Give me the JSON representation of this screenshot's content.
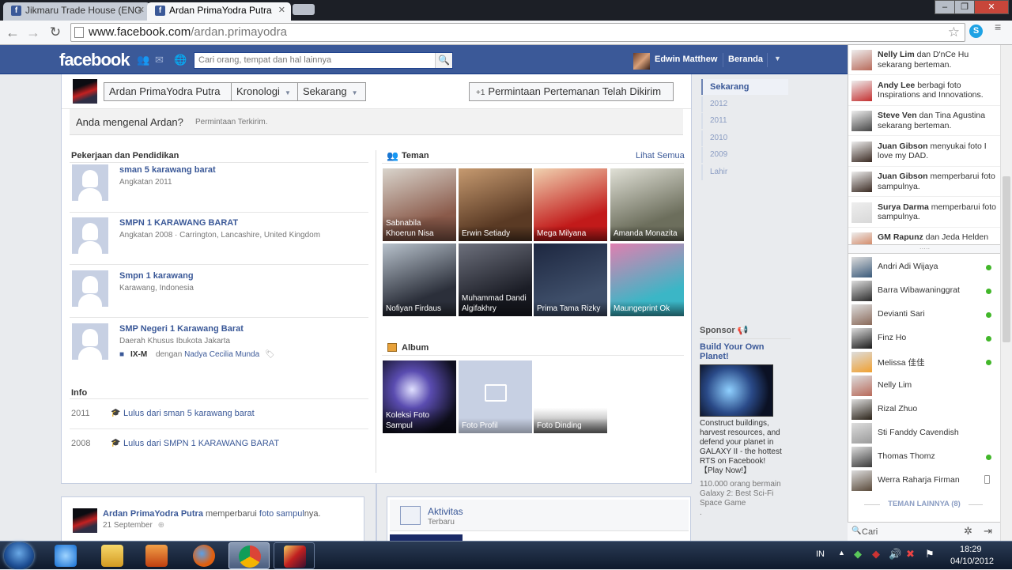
{
  "browser": {
    "tabs": [
      {
        "label": "Jikmaru Trade House (ENG"
      },
      {
        "label": "Ardan PrimaYodra Putra"
      }
    ],
    "url_host": "www.facebook.com",
    "url_path": "/ardan.primayodra"
  },
  "fb": {
    "logo": "facebook",
    "search_placeholder": "Cari orang, tempat dan hal lainnya",
    "user_name": "Edwin Matthew",
    "home_label": "Beranda"
  },
  "profile": {
    "name_btn": "Ardan PrimaYodra Putra",
    "kronologi_btn": "Kronologi",
    "sekarang_btn": "Sekarang",
    "friend_request_btn": "Permintaan Pertemanan Telah Dikirim",
    "know_question": "Anda mengenal Ardan?",
    "know_status": "Permintaan Terkirim."
  },
  "work": {
    "heading": "Pekerjaan dan Pendidikan",
    "items": [
      {
        "title": "sman 5 karawang barat",
        "detail": "Angkatan 2011"
      },
      {
        "title": "SMPN 1 KARAWANG BARAT",
        "detail": "Angkatan 2008 · Carrington, Lancashire, United Kingdom"
      },
      {
        "title": "Smpn 1 karawang",
        "detail": "Karawang, Indonesia"
      },
      {
        "title": "SMP Negeri 1 Karawang Barat",
        "detail": "Daerah Khusus Ibukota Jakarta",
        "class": "IX-M",
        "with": "dengan",
        "with_name": "Nadya Cecilia Munda"
      }
    ]
  },
  "info": {
    "heading": "Info",
    "rows": [
      {
        "year": "2011",
        "text": "Lulus dari sman 5 karawang barat"
      },
      {
        "year": "2008",
        "text": "Lulus dari SMPN 1 KARAWANG BARAT"
      }
    ]
  },
  "friends": {
    "heading": "Teman",
    "see_all": "Lihat Semua",
    "items": [
      {
        "name": "Sabnabila Khoerun Nisa",
        "c1": "#8a5a4a",
        "c2": "#d9d4cc"
      },
      {
        "name": "Erwin Setiady",
        "c1": "#5a3a24",
        "c2": "#c69a70"
      },
      {
        "name": "Mega Milyana",
        "c1": "#c21a1a",
        "c2": "#f0d2b0"
      },
      {
        "name": "Amanda Monazita",
        "c1": "#6c6e5c",
        "c2": "#e0e0d6"
      },
      {
        "name": "Nofiyan Firdaus",
        "c1": "#2b2f3a",
        "c2": "#b8c2cc"
      },
      {
        "name": "Muhammad Dandi Algifakhry",
        "c1": "#1b1d26",
        "c2": "#6d707c"
      },
      {
        "name": "Prima Tama Rizky",
        "c1": "#3f4f6a",
        "c2": "#1d2740"
      },
      {
        "name": "Maungeprint Ok",
        "c1": "#3bb6c6",
        "c2": "#e07fb0"
      }
    ]
  },
  "album": {
    "heading": "Album",
    "items": [
      {
        "name": "Koleksi Foto Sampul"
      },
      {
        "name": "Foto Profil"
      },
      {
        "name": "Foto Dinding"
      }
    ]
  },
  "timeline": {
    "items": [
      "Sekarang",
      "2012",
      "2011",
      "2010",
      "2009",
      "Lahir"
    ]
  },
  "sponsor": {
    "heading": "Sponsor",
    "title": "Build Your Own Planet!",
    "body": "Construct buildings, harvest resources, and defend your planet in GALAXY II - the hottest RTS on Facebook! 【Play Now!】",
    "social": "110.000 orang bermain Galaxy 2: Best Sci-Fi Space Game",
    "dot": "."
  },
  "story": {
    "name": "Ardan PrimaYodra Putra",
    "action": "memperbarui",
    "link": "foto sampul",
    "suffix": "nya.",
    "date": "21 September"
  },
  "activity": {
    "title": "Aktivitas",
    "sub": "Terbaru"
  },
  "ticker": [
    {
      "name": "Nelly Lim",
      "text": "dan D'nCe Hu sekarang berteman.",
      "c": "#b86a5a"
    },
    {
      "name": "Andy Lee",
      "text": "berbagi foto Inspirations and Innovations.",
      "c": "#c43030"
    },
    {
      "name": "Steve Ven",
      "text": "dan Tina Agustina sekarang berteman.",
      "c": "#444"
    },
    {
      "name": "Juan Gibson",
      "text": "menyukai foto I love my DAD.",
      "c": "#3a2a22"
    },
    {
      "name": "Juan Gibson",
      "text": "memperbarui foto sampulnya.",
      "c": "#3a2a22"
    },
    {
      "name": "Surya Darma",
      "text": "memperbarui foto sampulnya.",
      "c": "#d8d8d8"
    },
    {
      "name": "GM Rapunz",
      "text": "dan Jeda Helden",
      "c": "#c86030"
    }
  ],
  "chat_friends": [
    {
      "name": "Andri Adi Wijaya",
      "status": "online",
      "c": "#3a5a7a"
    },
    {
      "name": "Barra Wibawaninggrat",
      "status": "online",
      "c": "#2a2a2a"
    },
    {
      "name": "Devianti Sari",
      "status": "online",
      "c": "#8a6a5a"
    },
    {
      "name": "Finz Ho",
      "status": "online",
      "c": "#1a1a1a"
    },
    {
      "name": "Melissa 佳佳",
      "status": "online",
      "c": "#f0a030"
    },
    {
      "name": "Nelly Lim",
      "status": "none",
      "c": "#b86a5a"
    },
    {
      "name": "Rizal Zhuo",
      "status": "none",
      "c": "#2a2218"
    },
    {
      "name": "Sti Fanddy Cavendish",
      "status": "none",
      "c": "#9a9a9a"
    },
    {
      "name": "Thomas Thomz",
      "status": "online",
      "c": "#3a3a3a"
    },
    {
      "name": "Werra Raharja Firman",
      "status": "mobile",
      "c": "#5a4a3a"
    }
  ],
  "chat": {
    "other_friends": "TEMAN LAINNYA (8)",
    "search_placeholder": "Cari"
  },
  "taskbar": {
    "lang": "IN",
    "time": "18:29",
    "date": "04/10/2012"
  }
}
